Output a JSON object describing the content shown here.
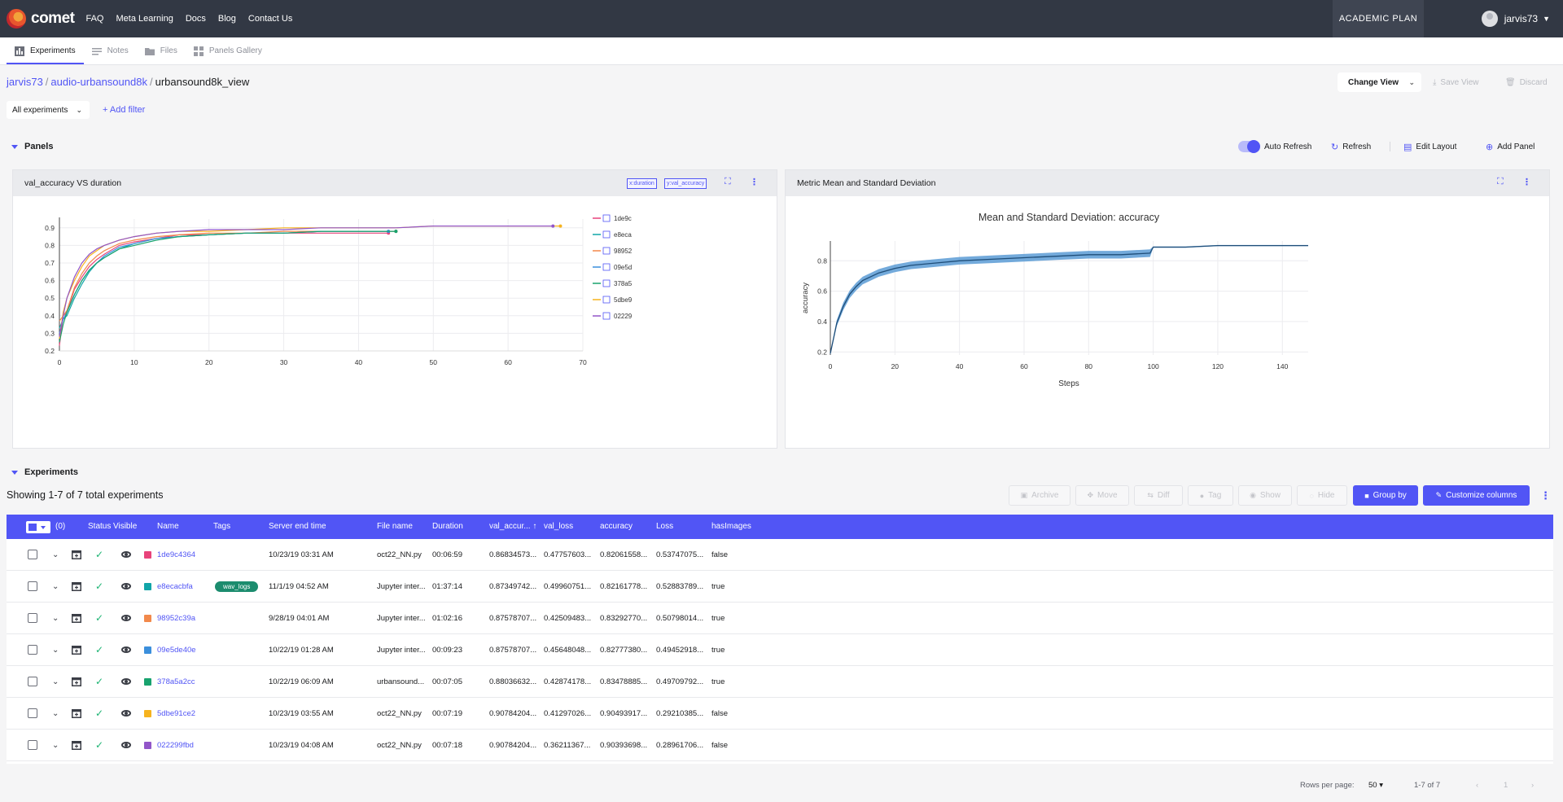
{
  "nav": {
    "brand": "comet",
    "links": [
      "FAQ",
      "Meta Learning",
      "Docs",
      "Blog",
      "Contact Us"
    ],
    "plan": "ACADEMIC PLAN",
    "user": "jarvis73"
  },
  "subnav": {
    "tabs": [
      {
        "label": "Experiments",
        "icon": "bar-chart-icon",
        "active": true
      },
      {
        "label": "Notes",
        "icon": "notes-icon",
        "active": false
      },
      {
        "label": "Files",
        "icon": "folder-icon",
        "active": false
      },
      {
        "label": "Panels Gallery",
        "icon": "dashboard-icon",
        "active": false
      }
    ]
  },
  "breadcrumb": {
    "workspace": "jarvis73",
    "project": "audio-urbansound8k",
    "view": "urbansound8k_view"
  },
  "view_actions": {
    "change_view": "Change View",
    "save_view": "Save View",
    "discard": "Discard"
  },
  "filters": {
    "selected": "All experiments",
    "add_filter": "Add filter"
  },
  "panels": {
    "title": "Panels",
    "auto_refresh": "Auto Refresh",
    "auto_refresh_on": true,
    "refresh": "Refresh",
    "edit_layout": "Edit Layout",
    "add_panel": "Add Panel",
    "panel1": {
      "title": "val_accuracy VS duration",
      "x_chip": "x:duration",
      "y_chip": "y:val_accuracy"
    },
    "panel2": {
      "title": "Metric Mean and Standard Deviation"
    }
  },
  "chart_data": [
    {
      "type": "line",
      "xlim": [
        0,
        70
      ],
      "ylim": [
        0.2,
        0.95
      ],
      "xticks": [
        0,
        10,
        20,
        30,
        40,
        50,
        60,
        70
      ],
      "yticks": [
        0.2,
        0.3,
        0.4,
        0.5,
        0.6,
        0.7,
        0.8,
        0.9
      ],
      "legend_position": "right",
      "series": [
        {
          "name": "1de9c",
          "color": "#e8437a",
          "x": [
            0,
            0.5,
            1,
            2,
            3,
            4,
            5,
            6,
            8,
            10,
            13,
            16,
            20,
            25,
            30,
            35,
            40,
            44
          ],
          "y": [
            0.23,
            0.4,
            0.42,
            0.55,
            0.62,
            0.68,
            0.72,
            0.75,
            0.8,
            0.82,
            0.84,
            0.86,
            0.86,
            0.87,
            0.87,
            0.87,
            0.87,
            0.87
          ]
        },
        {
          "name": "e8eca",
          "color": "#11a5a8",
          "x": [
            0,
            0.5,
            1,
            2,
            3,
            4,
            5,
            6,
            8,
            10,
            13,
            16,
            20,
            25,
            30,
            35,
            40,
            45
          ],
          "y": [
            0.33,
            0.38,
            0.4,
            0.5,
            0.58,
            0.65,
            0.7,
            0.73,
            0.78,
            0.81,
            0.84,
            0.85,
            0.86,
            0.87,
            0.87,
            0.88,
            0.88,
            0.88
          ]
        },
        {
          "name": "98952",
          "color": "#f2894b",
          "x": [
            0,
            0.5,
            1,
            2,
            3,
            4,
            5,
            6,
            8,
            10,
            13,
            16,
            20,
            25,
            30,
            35,
            40,
            45
          ],
          "y": [
            0.37,
            0.4,
            0.43,
            0.56,
            0.64,
            0.7,
            0.74,
            0.77,
            0.81,
            0.83,
            0.85,
            0.86,
            0.87,
            0.87,
            0.88,
            0.88,
            0.88,
            0.88
          ]
        },
        {
          "name": "09e5d",
          "color": "#3b8fdc",
          "x": [
            0,
            0.5,
            1,
            2,
            3,
            4,
            5,
            6,
            8,
            10,
            13,
            16,
            20,
            25,
            30,
            35,
            40,
            44
          ],
          "y": [
            0.3,
            0.38,
            0.42,
            0.52,
            0.6,
            0.66,
            0.7,
            0.74,
            0.79,
            0.81,
            0.84,
            0.85,
            0.86,
            0.87,
            0.87,
            0.88,
            0.88,
            0.88
          ]
        },
        {
          "name": "378a5",
          "color": "#18a36e",
          "x": [
            0,
            0.5,
            1,
            2,
            3,
            4,
            5,
            6,
            8,
            10,
            13,
            16,
            20,
            25,
            30,
            35,
            40,
            45
          ],
          "y": [
            0.25,
            0.35,
            0.42,
            0.52,
            0.6,
            0.66,
            0.7,
            0.73,
            0.78,
            0.8,
            0.83,
            0.85,
            0.86,
            0.87,
            0.87,
            0.88,
            0.88,
            0.88
          ]
        },
        {
          "name": "5dbe9",
          "color": "#f6b31e",
          "x": [
            0,
            0.5,
            1,
            2,
            3,
            4,
            5,
            6,
            8,
            10,
            13,
            16,
            20,
            25,
            30,
            35,
            40,
            45,
            50,
            55,
            60,
            65,
            67
          ],
          "y": [
            0.27,
            0.42,
            0.5,
            0.6,
            0.68,
            0.74,
            0.77,
            0.8,
            0.83,
            0.85,
            0.87,
            0.88,
            0.88,
            0.89,
            0.9,
            0.9,
            0.9,
            0.9,
            0.91,
            0.91,
            0.91,
            0.91,
            0.91
          ]
        },
        {
          "name": "02229",
          "color": "#9256c9",
          "x": [
            0,
            0.5,
            1,
            2,
            3,
            4,
            5,
            6,
            8,
            10,
            13,
            16,
            20,
            25,
            30,
            35,
            40,
            45,
            50,
            55,
            60,
            65,
            66
          ],
          "y": [
            0.28,
            0.4,
            0.5,
            0.62,
            0.7,
            0.75,
            0.78,
            0.8,
            0.83,
            0.85,
            0.87,
            0.88,
            0.89,
            0.89,
            0.89,
            0.9,
            0.9,
            0.9,
            0.91,
            0.91,
            0.91,
            0.91,
            0.91
          ]
        }
      ]
    },
    {
      "type": "line",
      "title": "Mean and Standard Deviation: accuracy",
      "xlabel": "Steps",
      "ylabel": "accuracy",
      "xlim": [
        0,
        148
      ],
      "ylim": [
        0.18,
        0.93
      ],
      "xticks": [
        0,
        20,
        40,
        60,
        80,
        100,
        120,
        140
      ],
      "yticks": [
        0.2,
        0.4,
        0.6,
        0.8
      ],
      "series": [
        {
          "name": "mean",
          "color": "#1f4e79",
          "band_color": "#5b9bd5",
          "x": [
            0,
            2,
            4,
            6,
            8,
            10,
            15,
            20,
            25,
            30,
            40,
            50,
            60,
            70,
            80,
            90,
            99,
            100,
            110,
            120,
            130,
            140,
            148
          ],
          "y": [
            0.19,
            0.39,
            0.5,
            0.58,
            0.63,
            0.67,
            0.72,
            0.75,
            0.77,
            0.78,
            0.8,
            0.81,
            0.82,
            0.83,
            0.84,
            0.84,
            0.85,
            0.89,
            0.89,
            0.9,
            0.9,
            0.9,
            0.9
          ],
          "std": [
            0.01,
            0.02,
            0.025,
            0.025,
            0.025,
            0.025,
            0.025,
            0.025,
            0.025,
            0.025,
            0.025,
            0.025,
            0.025,
            0.025,
            0.025,
            0.025,
            0.025,
            0.004,
            0.004,
            0.004,
            0.004,
            0.004,
            0.004
          ]
        }
      ]
    }
  ],
  "experiments": {
    "title": "Experiments",
    "showing": "Showing 1-7 of 7 total experiments",
    "actions": {
      "archive": "Archive",
      "move": "Move",
      "diff": "Diff",
      "tag": "Tag",
      "show": "Show",
      "hide": "Hide",
      "group_by": "Group by",
      "customize": "Customize columns"
    },
    "selected_count": "(0)",
    "columns": [
      "Status",
      "Visible",
      "Name",
      "Tags",
      "Server end time",
      "File name",
      "Duration",
      "val_accur...",
      "val_loss",
      "accuracy",
      "Loss",
      "hasImages"
    ],
    "rows": [
      {
        "color": "#e8437a",
        "name": "1de9c4364",
        "tag": "",
        "end": "10/23/19 03:31 AM",
        "file": "oct22_NN.py",
        "duration": "00:06:59",
        "val_acc": "0.86834573...",
        "val_loss": "0.47757603...",
        "acc": "0.82061558...",
        "loss": "0.53747075...",
        "images": "false"
      },
      {
        "color": "#11a5a8",
        "name": "e8ecacbfa",
        "tag": "wav_logs",
        "end": "11/1/19 04:52 AM",
        "file": "Jupyter inter...",
        "duration": "01:37:14",
        "val_acc": "0.87349742...",
        "val_loss": "0.49960751...",
        "acc": "0.82161778...",
        "loss": "0.52883789...",
        "images": "true"
      },
      {
        "color": "#f2894b",
        "name": "98952c39a",
        "tag": "",
        "end": "9/28/19 04:01 AM",
        "file": "Jupyter inter...",
        "duration": "01:02:16",
        "val_acc": "0.87578707...",
        "val_loss": "0.42509483...",
        "acc": "0.83292770...",
        "loss": "0.50798014...",
        "images": "true"
      },
      {
        "color": "#3b8fdc",
        "name": "09e5de40e",
        "tag": "",
        "end": "10/22/19 01:28 AM",
        "file": "Jupyter inter...",
        "duration": "00:09:23",
        "val_acc": "0.87578707...",
        "val_loss": "0.45648048...",
        "acc": "0.82777380...",
        "loss": "0.49452918...",
        "images": "true"
      },
      {
        "color": "#18a36e",
        "name": "378a5a2cc",
        "tag": "",
        "end": "10/22/19 06:09 AM",
        "file": "urbansound...",
        "duration": "00:07:05",
        "val_acc": "0.88036632...",
        "val_loss": "0.42874178...",
        "acc": "0.83478885...",
        "loss": "0.49709792...",
        "images": "true"
      },
      {
        "color": "#f6b31e",
        "name": "5dbe91ce2",
        "tag": "",
        "end": "10/23/19 03:55 AM",
        "file": "oct22_NN.py",
        "duration": "00:07:19",
        "val_acc": "0.90784204...",
        "val_loss": "0.41297026...",
        "acc": "0.90493917...",
        "loss": "0.29210385...",
        "images": "false"
      },
      {
        "color": "#9256c9",
        "name": "022299fbd",
        "tag": "",
        "end": "10/23/19 04:08 AM",
        "file": "oct22_NN.py",
        "duration": "00:07:18",
        "val_acc": "0.90784204...",
        "val_loss": "0.36211367...",
        "acc": "0.90393698...",
        "loss": "0.28961706...",
        "images": "false"
      }
    ],
    "pagination": {
      "rows_per_page_label": "Rows per page:",
      "rows_per_page": "50",
      "range": "1-7 of 7",
      "page": "1"
    }
  }
}
